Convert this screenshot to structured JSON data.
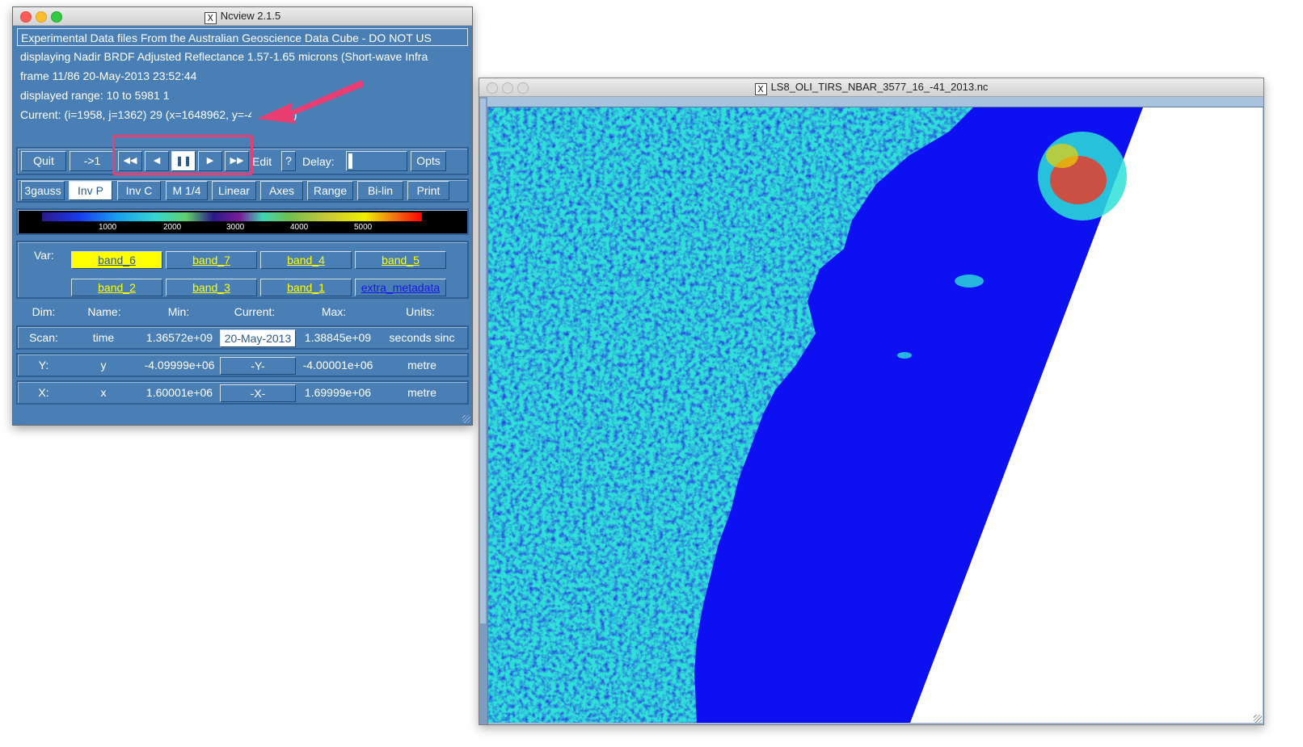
{
  "control_window": {
    "title": "Ncview 2.1.5",
    "info": {
      "title_line": "Experimental Data files From the Australian Geoscience Data Cube - DO NOT US",
      "displaying": "displaying Nadir BRDF Adjusted Reflectance 1.57-1.65 microns (Short-wave Infra",
      "frame": "frame 11/86 20-May-2013 23:52:44",
      "range": "displayed range: 10 to 5981 1",
      "current": "Current: (i=1958, j=1362) 29 (x=1648962, y=-40",
      "current_tail": "2)"
    },
    "toolbar": {
      "quit": "Quit",
      "goto1": "->1",
      "rewind": "◀◀",
      "back": "◀",
      "pause": "❚❚",
      "forward": "▶",
      "fastforward": "▶▶",
      "edit": "Edit",
      "help": "?",
      "delay_label": "Delay:",
      "opts": "Opts"
    },
    "options": [
      "3gauss",
      "Inv P",
      "Inv C",
      "M 1/4",
      "Linear",
      "Axes",
      "Range",
      "Bi-lin",
      "Print"
    ],
    "active_option": "Inv P",
    "colorbar_ticks": [
      "1000",
      "2000",
      "3000",
      "4000",
      "5000"
    ],
    "var_label": "Var:",
    "vars": [
      "band_6",
      "band_7",
      "band_4",
      "band_5",
      "band_2",
      "band_3",
      "band_1",
      "extra_metadata"
    ],
    "selected_var": "band_6",
    "dim_headers": [
      "Dim:",
      "Name:",
      "Min:",
      "Current:",
      "Max:",
      "Units:"
    ],
    "dims": [
      {
        "dim": "Scan:",
        "name": "time",
        "min": "1.36572e+09",
        "current": "20-May-2013",
        "max": "1.38845e+09",
        "units": "seconds sinc"
      },
      {
        "dim": "Y:",
        "name": "y",
        "min": "-4.09999e+06",
        "current": "-Y-",
        "max": "-4.00001e+06",
        "units": "metre"
      },
      {
        "dim": "X:",
        "name": "x",
        "min": "1.60001e+06",
        "current": "-X-",
        "max": "1.69999e+06",
        "units": "metre"
      }
    ]
  },
  "image_window": {
    "title": "LS8_OLI_TIRS_NBAR_3577_16_-41_2013.nc"
  },
  "colors": {
    "panel_blue": "#4a7fb5",
    "annotation_pink": "#ea3e72",
    "ocean_blue": "#0d10f0",
    "land_cyan": "#2ee0d8"
  }
}
